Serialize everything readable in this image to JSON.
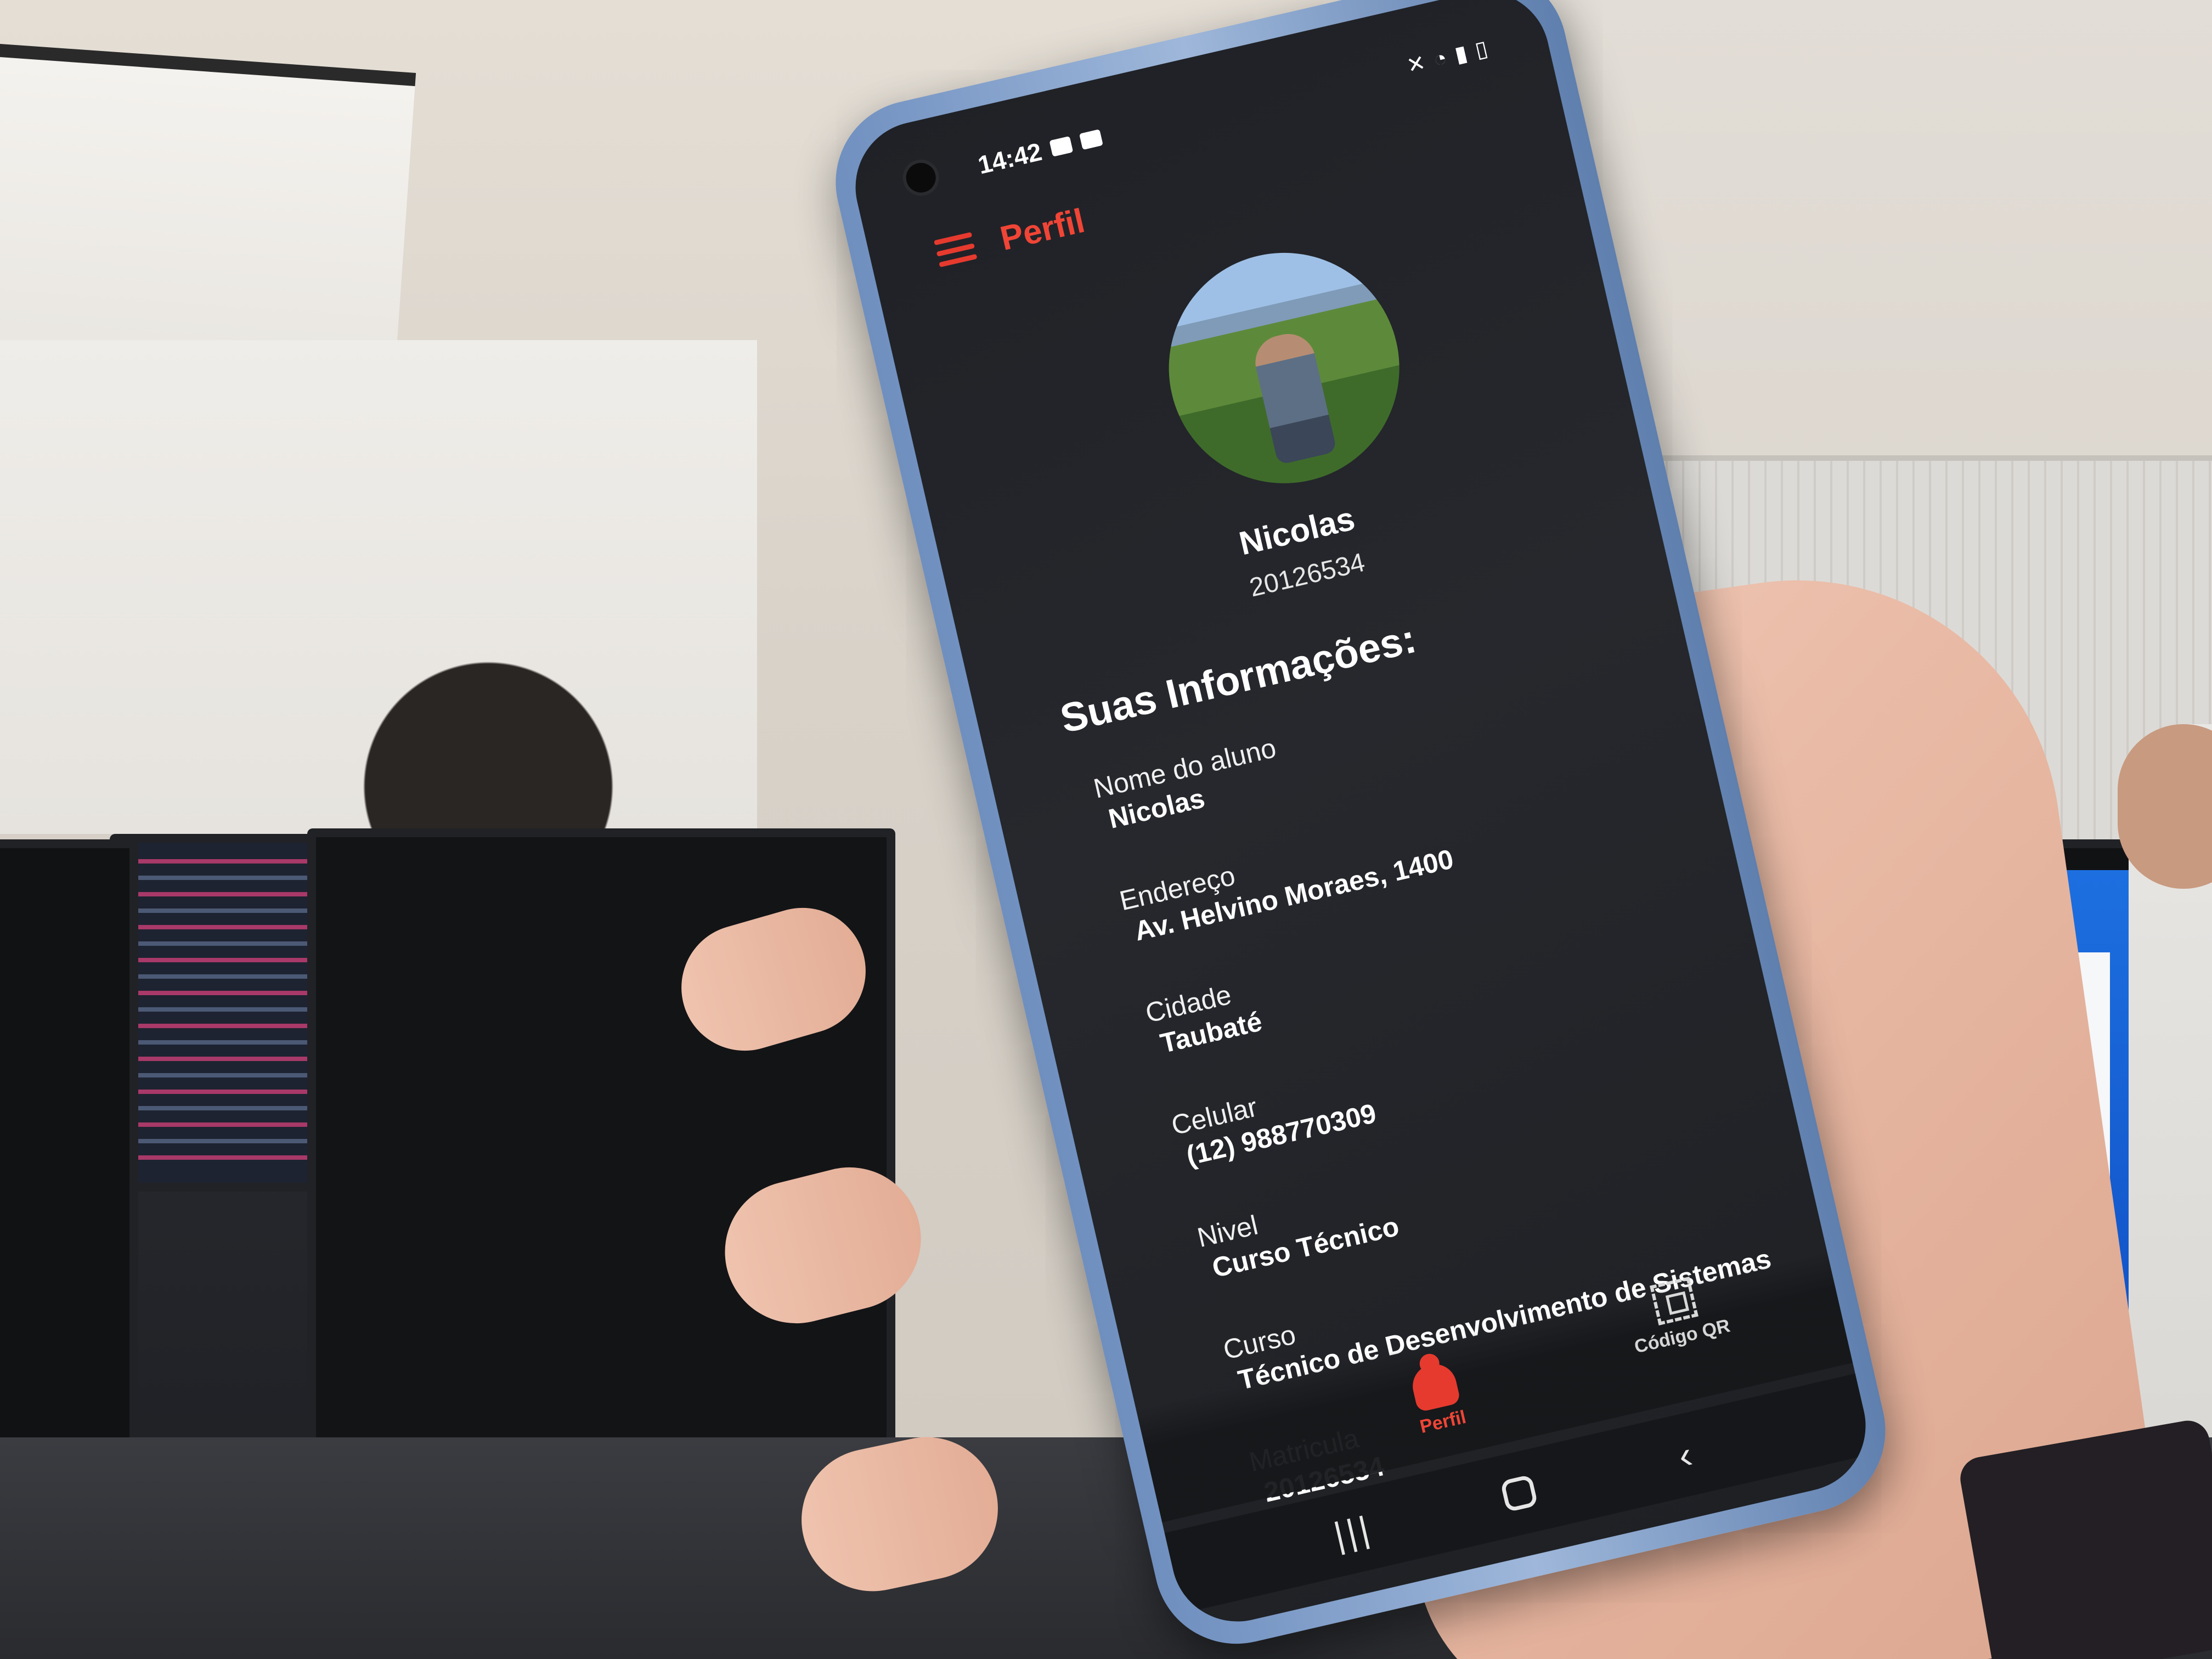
{
  "status_bar": {
    "time": "14:42"
  },
  "app_bar": {
    "title": "Perfil",
    "menu_icon": "hamburger-icon",
    "accent_color": "#f04536"
  },
  "profile": {
    "name": "Nicolas",
    "id": "20126534"
  },
  "section": {
    "title": "Suas Informações:"
  },
  "info": [
    {
      "label": "Nome do aluno",
      "value": "Nicolas"
    },
    {
      "label": "Endereço",
      "value": "Av. Helvino Moraes, 1400"
    },
    {
      "label": "Cidade",
      "value": "Taubaté"
    },
    {
      "label": "Celular",
      "value": "(12) 988770309"
    },
    {
      "label": "Nivel",
      "value": "Curso Técnico"
    },
    {
      "label": "Curso",
      "value": "Técnico de Desenvolvimento de Sistemas"
    },
    {
      "label": "Matricula",
      "value": "20126534"
    }
  ],
  "bottom_nav": {
    "perfil_label": "Perfil",
    "qr_label": "Código QR",
    "perfil_icon": "profile-icon",
    "qr_icon": "qr-code-icon"
  },
  "system_nav": {
    "recents_icon": "recents-icon",
    "home_icon": "home-icon",
    "back_icon": "back-icon"
  }
}
